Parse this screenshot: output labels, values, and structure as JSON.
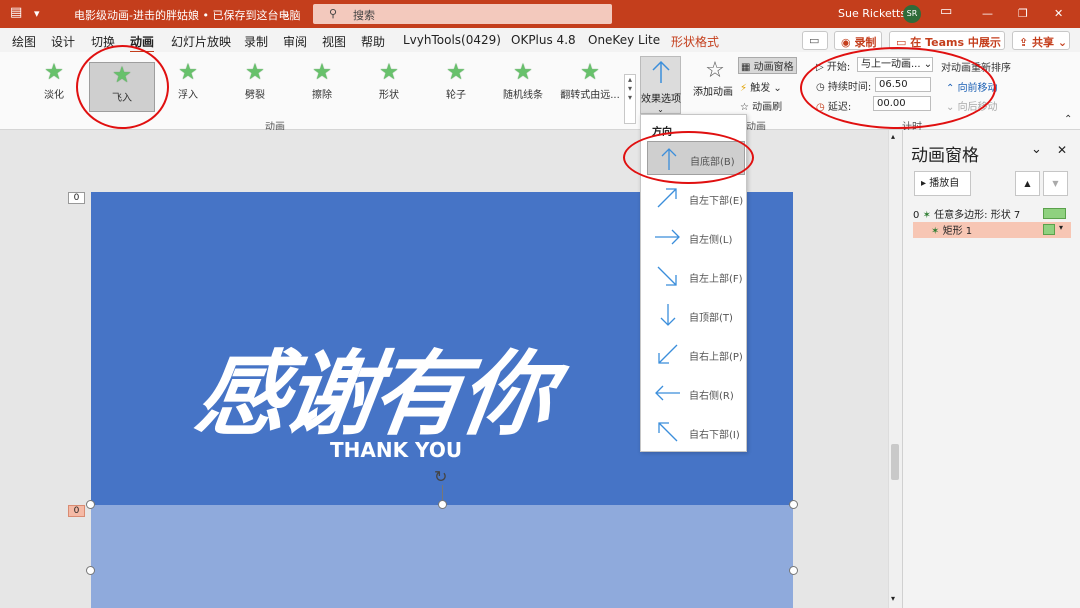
{
  "titlebar": {
    "icon": "presentation-icon",
    "doc_title": "电影级动画-进击的胖姑娘 • 已保存到这台电脑",
    "search_placeholder": "搜索",
    "user": "Sue Ricketts",
    "initials": "SR",
    "bg_color": "#c43e1c"
  },
  "tabs": [
    "绘图",
    "设计",
    "切换",
    "动画",
    "幻灯片放映",
    "录制",
    "审阅",
    "视图",
    "帮助",
    "LvyhTools(0429)",
    "OKPlus 4.8",
    "OneKey Lite",
    "形状格式"
  ],
  "tab_active": "动画",
  "tab_buttons": {
    "record": "录制",
    "teams": "在 Teams 中展示",
    "share": "共享"
  },
  "animations": [
    {
      "label": "淡化",
      "selected": false
    },
    {
      "label": "飞入",
      "selected": true
    },
    {
      "label": "浮入",
      "selected": false
    },
    {
      "label": "劈裂",
      "selected": false
    },
    {
      "label": "擦除",
      "selected": false
    },
    {
      "label": "形状",
      "selected": false
    },
    {
      "label": "轮子",
      "selected": false
    },
    {
      "label": "随机线条",
      "selected": false
    },
    {
      "label": "翻转式由远...",
      "selected": false
    }
  ],
  "ribbon": {
    "group_animation": "动画",
    "effect_options": "效果选项",
    "add_animation": "添加动画",
    "animation_pane": "动画窗格",
    "trigger": "触发",
    "painter": "动画刷",
    "group_advanced": "动画",
    "start_label": "开始:",
    "start_value": "与上一动画...",
    "duration_label": "持续时间:",
    "duration_value": "06.50",
    "delay_label": "延迟:",
    "delay_value": "00.00",
    "reorder_title": "对动画重新排序",
    "move_earlier": "向前移动",
    "move_later": "向后移动",
    "group_timing": "计时"
  },
  "dropdown": {
    "heading": "方向",
    "items": [
      {
        "label": "自底部(B)",
        "icon": "arrow-up-icon",
        "selected": true
      },
      {
        "label": "自左下部(E)",
        "icon": "arrow-up-right-icon",
        "selected": false
      },
      {
        "label": "自左侧(L)",
        "icon": "arrow-right-icon",
        "selected": false
      },
      {
        "label": "自左上部(F)",
        "icon": "arrow-down-right-icon",
        "selected": false
      },
      {
        "label": "自顶部(T)",
        "icon": "arrow-down-icon",
        "selected": false
      },
      {
        "label": "自右上部(P)",
        "icon": "arrow-down-left-icon",
        "selected": false
      },
      {
        "label": "自右侧(R)",
        "icon": "arrow-left-icon",
        "selected": false
      },
      {
        "label": "自右下部(I)",
        "icon": "arrow-up-left-icon",
        "selected": false
      }
    ]
  },
  "slide": {
    "main_text": "感谢有你",
    "sub_text": "THANK YOU",
    "tag_top": "0",
    "tag_bottom": "0",
    "bg_color": "#4674c6",
    "bg_color_lower": "#8faadc"
  },
  "pane": {
    "title": "动画窗格",
    "play_button": "播放自",
    "items": [
      {
        "index": "0",
        "label": "任意多边形: 形状 7",
        "selected": false
      },
      {
        "index": "",
        "label": "矩形 1",
        "selected": true
      }
    ]
  }
}
